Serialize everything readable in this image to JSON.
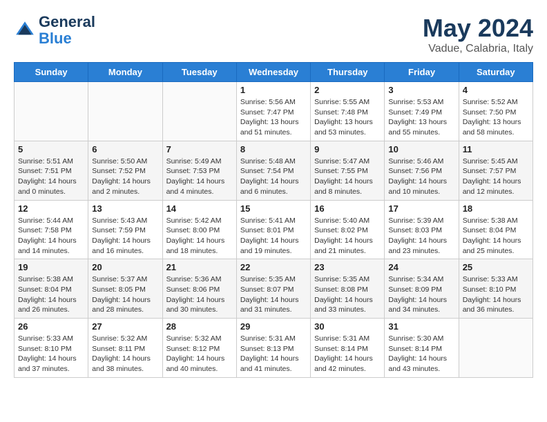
{
  "header": {
    "logo_line1": "General",
    "logo_line2": "Blue",
    "month": "May 2024",
    "location": "Vadue, Calabria, Italy"
  },
  "weekdays": [
    "Sunday",
    "Monday",
    "Tuesday",
    "Wednesday",
    "Thursday",
    "Friday",
    "Saturday"
  ],
  "weeks": [
    [
      {
        "day": "",
        "content": ""
      },
      {
        "day": "",
        "content": ""
      },
      {
        "day": "",
        "content": ""
      },
      {
        "day": "1",
        "content": "Sunrise: 5:56 AM\nSunset: 7:47 PM\nDaylight: 13 hours\nand 51 minutes."
      },
      {
        "day": "2",
        "content": "Sunrise: 5:55 AM\nSunset: 7:48 PM\nDaylight: 13 hours\nand 53 minutes."
      },
      {
        "day": "3",
        "content": "Sunrise: 5:53 AM\nSunset: 7:49 PM\nDaylight: 13 hours\nand 55 minutes."
      },
      {
        "day": "4",
        "content": "Sunrise: 5:52 AM\nSunset: 7:50 PM\nDaylight: 13 hours\nand 58 minutes."
      }
    ],
    [
      {
        "day": "5",
        "content": "Sunrise: 5:51 AM\nSunset: 7:51 PM\nDaylight: 14 hours\nand 0 minutes."
      },
      {
        "day": "6",
        "content": "Sunrise: 5:50 AM\nSunset: 7:52 PM\nDaylight: 14 hours\nand 2 minutes."
      },
      {
        "day": "7",
        "content": "Sunrise: 5:49 AM\nSunset: 7:53 PM\nDaylight: 14 hours\nand 4 minutes."
      },
      {
        "day": "8",
        "content": "Sunrise: 5:48 AM\nSunset: 7:54 PM\nDaylight: 14 hours\nand 6 minutes."
      },
      {
        "day": "9",
        "content": "Sunrise: 5:47 AM\nSunset: 7:55 PM\nDaylight: 14 hours\nand 8 minutes."
      },
      {
        "day": "10",
        "content": "Sunrise: 5:46 AM\nSunset: 7:56 PM\nDaylight: 14 hours\nand 10 minutes."
      },
      {
        "day": "11",
        "content": "Sunrise: 5:45 AM\nSunset: 7:57 PM\nDaylight: 14 hours\nand 12 minutes."
      }
    ],
    [
      {
        "day": "12",
        "content": "Sunrise: 5:44 AM\nSunset: 7:58 PM\nDaylight: 14 hours\nand 14 minutes."
      },
      {
        "day": "13",
        "content": "Sunrise: 5:43 AM\nSunset: 7:59 PM\nDaylight: 14 hours\nand 16 minutes."
      },
      {
        "day": "14",
        "content": "Sunrise: 5:42 AM\nSunset: 8:00 PM\nDaylight: 14 hours\nand 18 minutes."
      },
      {
        "day": "15",
        "content": "Sunrise: 5:41 AM\nSunset: 8:01 PM\nDaylight: 14 hours\nand 19 minutes."
      },
      {
        "day": "16",
        "content": "Sunrise: 5:40 AM\nSunset: 8:02 PM\nDaylight: 14 hours\nand 21 minutes."
      },
      {
        "day": "17",
        "content": "Sunrise: 5:39 AM\nSunset: 8:03 PM\nDaylight: 14 hours\nand 23 minutes."
      },
      {
        "day": "18",
        "content": "Sunrise: 5:38 AM\nSunset: 8:04 PM\nDaylight: 14 hours\nand 25 minutes."
      }
    ],
    [
      {
        "day": "19",
        "content": "Sunrise: 5:38 AM\nSunset: 8:04 PM\nDaylight: 14 hours\nand 26 minutes."
      },
      {
        "day": "20",
        "content": "Sunrise: 5:37 AM\nSunset: 8:05 PM\nDaylight: 14 hours\nand 28 minutes."
      },
      {
        "day": "21",
        "content": "Sunrise: 5:36 AM\nSunset: 8:06 PM\nDaylight: 14 hours\nand 30 minutes."
      },
      {
        "day": "22",
        "content": "Sunrise: 5:35 AM\nSunset: 8:07 PM\nDaylight: 14 hours\nand 31 minutes."
      },
      {
        "day": "23",
        "content": "Sunrise: 5:35 AM\nSunset: 8:08 PM\nDaylight: 14 hours\nand 33 minutes."
      },
      {
        "day": "24",
        "content": "Sunrise: 5:34 AM\nSunset: 8:09 PM\nDaylight: 14 hours\nand 34 minutes."
      },
      {
        "day": "25",
        "content": "Sunrise: 5:33 AM\nSunset: 8:10 PM\nDaylight: 14 hours\nand 36 minutes."
      }
    ],
    [
      {
        "day": "26",
        "content": "Sunrise: 5:33 AM\nSunset: 8:10 PM\nDaylight: 14 hours\nand 37 minutes."
      },
      {
        "day": "27",
        "content": "Sunrise: 5:32 AM\nSunset: 8:11 PM\nDaylight: 14 hours\nand 38 minutes."
      },
      {
        "day": "28",
        "content": "Sunrise: 5:32 AM\nSunset: 8:12 PM\nDaylight: 14 hours\nand 40 minutes."
      },
      {
        "day": "29",
        "content": "Sunrise: 5:31 AM\nSunset: 8:13 PM\nDaylight: 14 hours\nand 41 minutes."
      },
      {
        "day": "30",
        "content": "Sunrise: 5:31 AM\nSunset: 8:14 PM\nDaylight: 14 hours\nand 42 minutes."
      },
      {
        "day": "31",
        "content": "Sunrise: 5:30 AM\nSunset: 8:14 PM\nDaylight: 14 hours\nand 43 minutes."
      },
      {
        "day": "",
        "content": ""
      }
    ]
  ]
}
